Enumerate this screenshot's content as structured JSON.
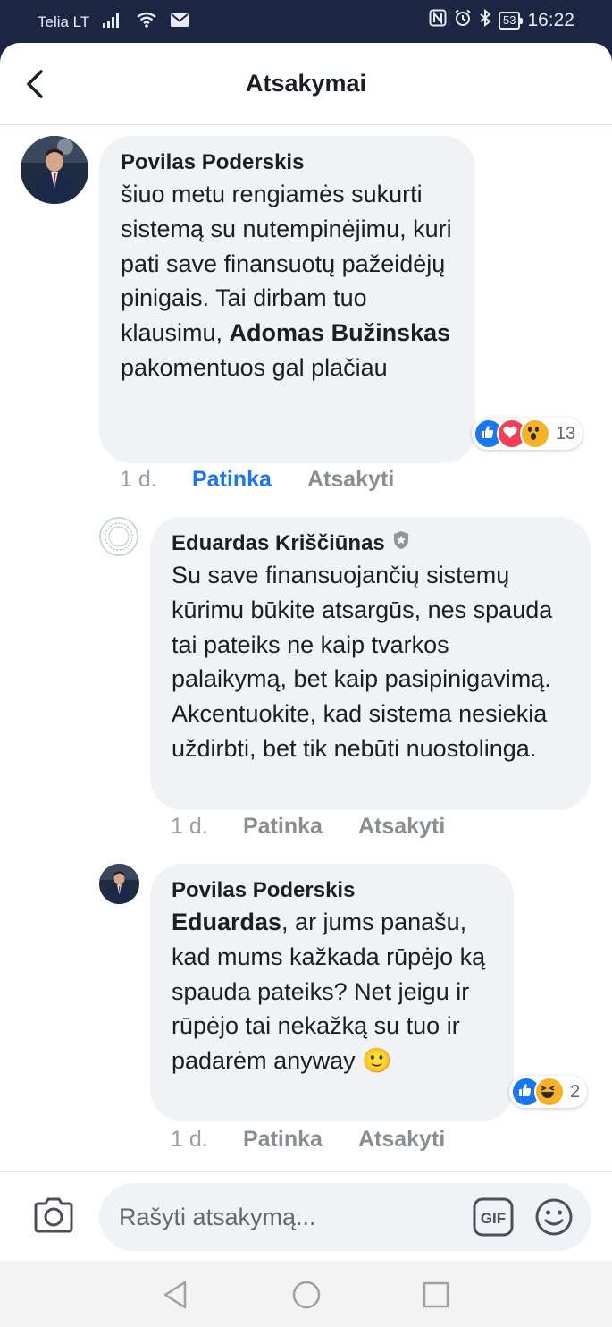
{
  "status_bar": {
    "carrier": "Telia LT",
    "battery": "53",
    "time": "16:22"
  },
  "header": {
    "title": "Atsakymai"
  },
  "comments": [
    {
      "author": "Povilas Poderskis",
      "text_parts": [
        "šiuo metu rengiamės sukurti sistemą su nutempinėjimu, kuri pati save finansuotų pažeidėjų pinigais. Tai dirbam tuo klausimu, ",
        "Adomas Bužinskas",
        " pakomentuos gal plačiau"
      ],
      "time": "1 d.",
      "like_label": "Patinka",
      "reply_label": "Atsakyti",
      "reactions": [
        "like",
        "love",
        "wow"
      ],
      "reaction_count": "13"
    },
    {
      "author": "Eduardas Kriščiūnas",
      "badge_icon": "shield-badge-icon",
      "text": "Su save finansuojančių sistemų kūrimu būkite atsargūs, nes spauda tai pateiks ne kaip tvarkos palaikymą, bet kaip pasipinigavimą. Akcentuokite, kad sistema nesiekia uždirbti, bet tik nebūti nuostolinga.",
      "time": "1 d.",
      "like_label": "Patinka",
      "reply_label": "Atsakyti"
    },
    {
      "author": "Povilas Poderskis",
      "mention": "Eduardas",
      "text": ", ar jums panašu, kad mums kažkada rūpėjo ką spauda pateiks? Net jeigu ir rūpėjo tai nekažką su tuo ir padarėm anyway",
      "emoji": "🙂",
      "time": "1 d.",
      "like_label": "Patinka",
      "reply_label": "Atsakyti",
      "reactions": [
        "like",
        "haha"
      ],
      "reaction_count": "2"
    }
  ],
  "composer": {
    "placeholder": "Rašyti atsakymą...",
    "gif_label": "GIF"
  },
  "colors": {
    "status_bar_bg": "#1c2541",
    "link_blue": "#1877f2",
    "bubble_bg": "#f0f2f5",
    "muted_text": "#8a8d91"
  }
}
